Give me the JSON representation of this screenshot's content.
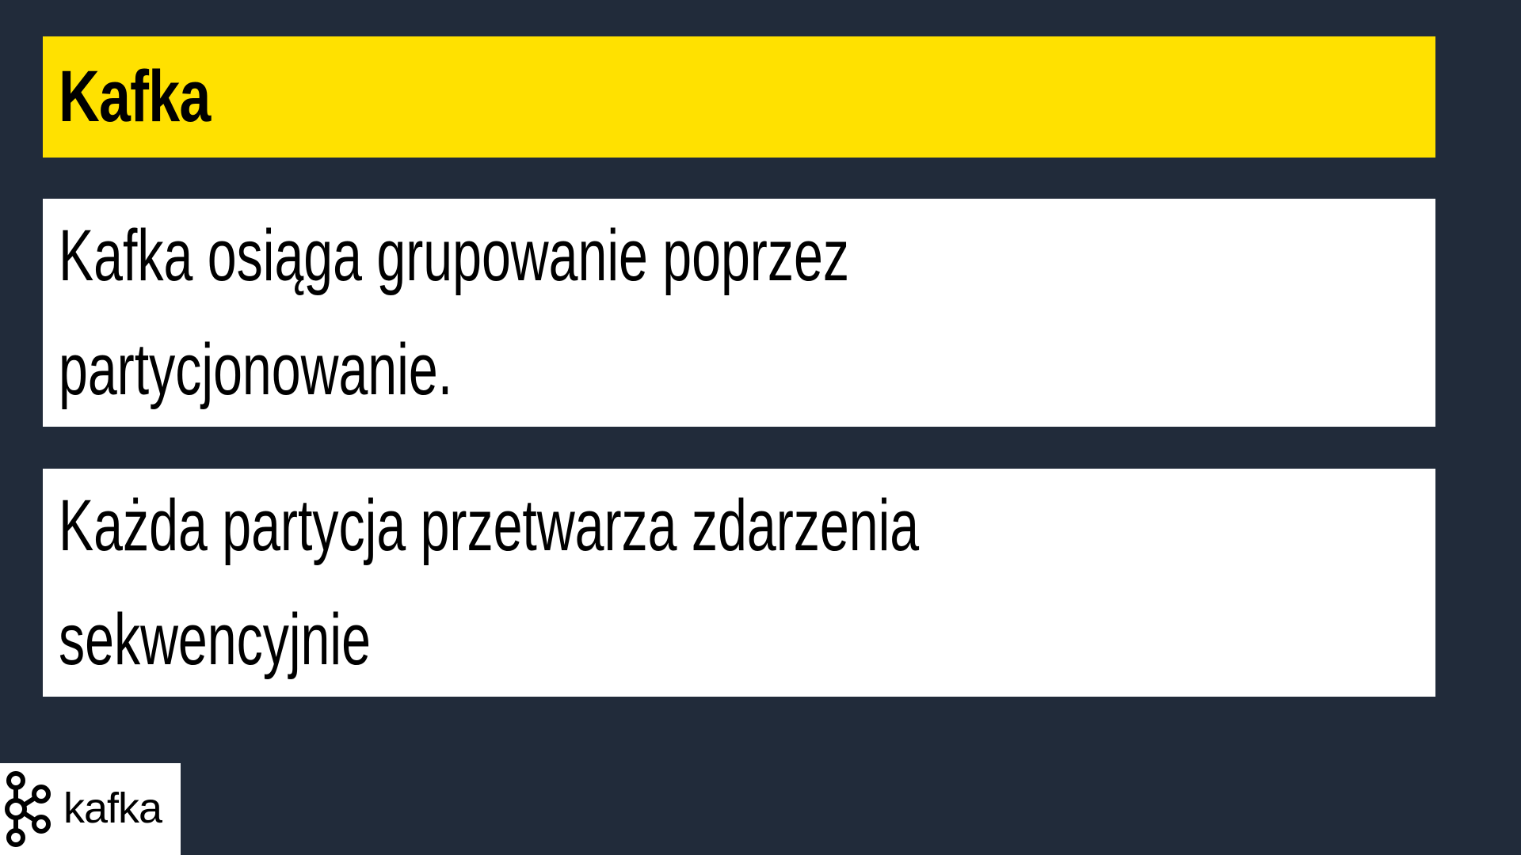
{
  "slide": {
    "title": "Kafka",
    "blocks": [
      {
        "lines": [
          "Kafka osiąga grupowanie poprzez",
          "partycjonowanie."
        ]
      },
      {
        "lines": [
          "Każda partycja przetwarza zdarzenia",
          "sekwencyjnie"
        ]
      }
    ]
  },
  "logo": {
    "icon": "kafka-logo-icon",
    "wordmark": "kafka"
  },
  "colors": {
    "background": "#212b3a",
    "title_bar": "#ffe100",
    "text_box": "#ffffff",
    "text": "#000000"
  }
}
